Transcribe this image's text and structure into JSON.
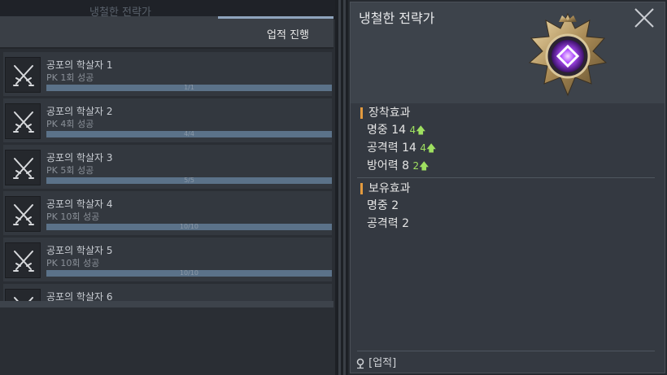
{
  "left_panel": {
    "background_title": "냉철한 전략가",
    "tab_label": "업적 진행",
    "achievements": [
      {
        "title": "공포의 학살자 1",
        "subtitle": "PK 1회 성공",
        "progress_text": "1/1",
        "progress": 1.0
      },
      {
        "title": "공포의 학살자 2",
        "subtitle": "PK 4회 성공",
        "progress_text": "4/4",
        "progress": 1.0
      },
      {
        "title": "공포의 학살자 3",
        "subtitle": "PK 5회 성공",
        "progress_text": "5/5",
        "progress": 1.0
      },
      {
        "title": "공포의 학살자 4",
        "subtitle": "PK 10회 성공",
        "progress_text": "10/10",
        "progress": 1.0
      },
      {
        "title": "공포의 학살자 5",
        "subtitle": "PK 10회 성공",
        "progress_text": "10/10",
        "progress": 1.0
      },
      {
        "title": "공포의 학살자 6",
        "subtitle": "",
        "progress_text": "",
        "progress": 0
      }
    ]
  },
  "detail": {
    "title": "냉철한 전략가",
    "equip": {
      "heading": "장착효과",
      "stats": [
        {
          "name": "명중",
          "value": "14",
          "bonus": "4"
        },
        {
          "name": "공격력",
          "value": "14",
          "bonus": "4"
        },
        {
          "name": "방어력",
          "value": "8",
          "bonus": "2"
        }
      ]
    },
    "owned": {
      "heading": "보유효과",
      "stats": [
        {
          "name": "명중",
          "value": "2"
        },
        {
          "name": "공격력",
          "value": "2"
        }
      ]
    },
    "footer": "[업적]"
  },
  "colors": {
    "accent_orange": "#e39a3e",
    "bonus_green": "#9fe060",
    "progress_blue": "#5b7289"
  },
  "icons": [
    "crossed-swords-icon",
    "close-icon",
    "location-pin-icon",
    "achievement-badge-icon",
    "up-arrow-icon"
  ]
}
